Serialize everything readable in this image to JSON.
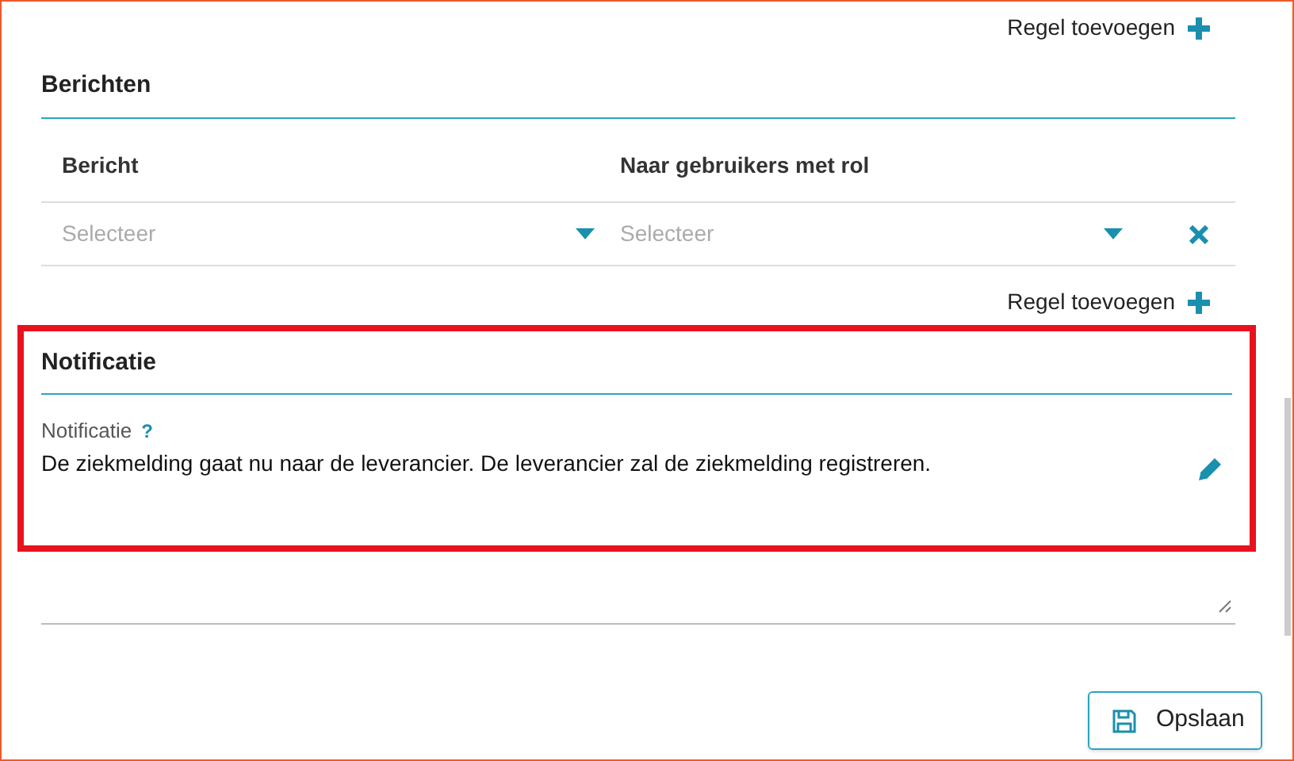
{
  "add_row_top": "Regel toevoegen",
  "berichten": {
    "title": "Berichten",
    "columns": [
      "Bericht",
      "Naar gebruikers met rol"
    ],
    "rows": [
      {
        "cells": [
          {
            "placeholder": "Selecteer"
          },
          {
            "placeholder": "Selecteer"
          }
        ]
      }
    ],
    "add_row": "Regel toevoegen"
  },
  "notificatie": {
    "title": "Notificatie",
    "label": "Notificatie",
    "help": "?",
    "text": "De ziekmelding gaat nu naar de leverancier. De leverancier zal de ziekmelding registreren."
  },
  "save_button": "Opslaan"
}
